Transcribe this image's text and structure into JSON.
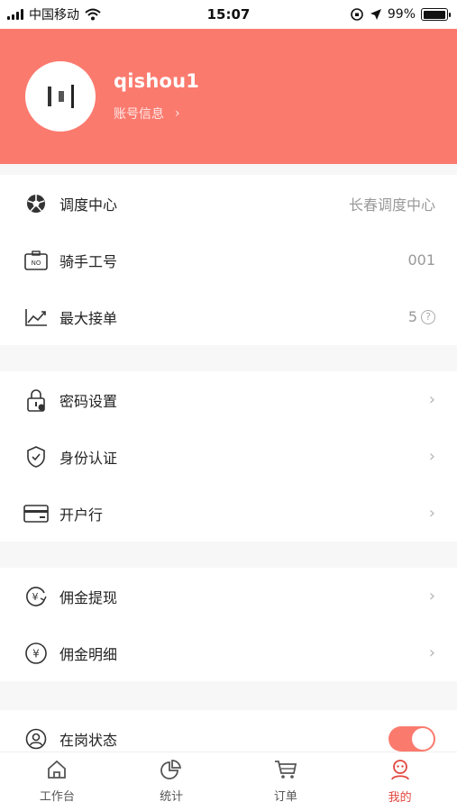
{
  "status_bar": {
    "carrier": "中国移动",
    "time": "15:07",
    "battery": "99%",
    "battery_level": 0.99
  },
  "profile": {
    "username": "qishou1",
    "account_link": "账号信息"
  },
  "info_section": [
    {
      "label": "调度中心",
      "value": "长春调度中心",
      "icon": "aperture-icon"
    },
    {
      "label": "骑手工号",
      "value": "001",
      "icon": "id-badge-icon"
    },
    {
      "label": "最大接单",
      "value": "5",
      "icon": "trend-chart-icon"
    }
  ],
  "account_section": [
    {
      "label": "密码设置",
      "icon": "lock-icon"
    },
    {
      "label": "身份认证",
      "icon": "shield-check-icon"
    },
    {
      "label": "开户行",
      "icon": "bank-card-icon"
    }
  ],
  "commission_section": [
    {
      "label": "佣金提现",
      "icon": "yuan-withdraw-icon"
    },
    {
      "label": "佣金明细",
      "icon": "yuan-circle-icon"
    }
  ],
  "status_section": {
    "label": "在岗状态",
    "on_duty": true
  },
  "tab_bar": [
    {
      "label": "工作台",
      "icon": "home-icon",
      "active": false
    },
    {
      "label": "统计",
      "icon": "pie-chart-icon",
      "active": false
    },
    {
      "label": "订单",
      "icon": "cart-icon",
      "active": false
    },
    {
      "label": "我的",
      "icon": "user-face-icon",
      "active": true
    }
  ],
  "colors": {
    "accent": "#fb7a6e",
    "active_tab": "#e2473f"
  }
}
